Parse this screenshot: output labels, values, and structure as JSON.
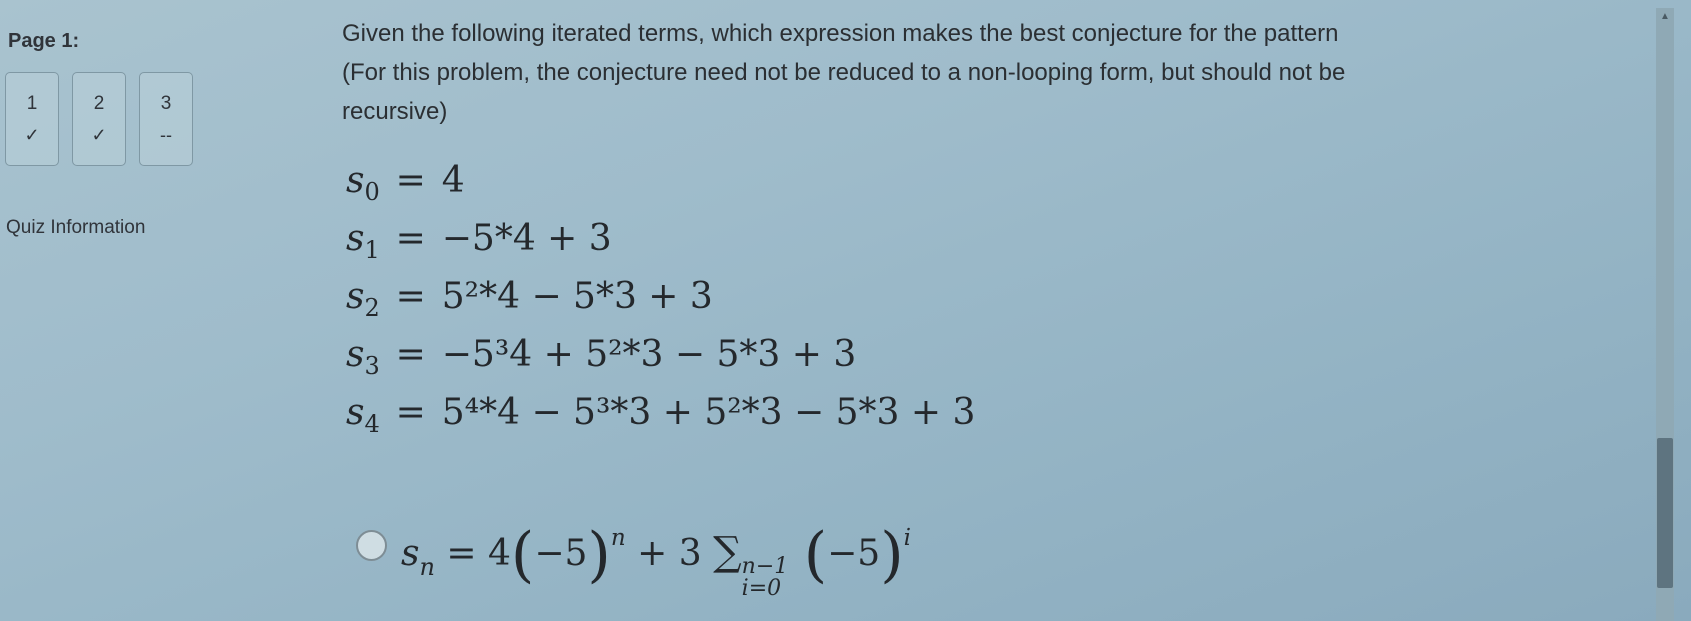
{
  "sidebar": {
    "page_label": "Page 1:",
    "questions": [
      {
        "number": "1",
        "status": "✓",
        "answered": true
      },
      {
        "number": "2",
        "status": "✓",
        "answered": true
      },
      {
        "number": "3",
        "status": "--",
        "answered": false
      }
    ],
    "quiz_info_label": "Quiz Information"
  },
  "question": {
    "prompt": "Given the following iterated terms, which expression makes the best conjecture for the pattern (For this problem, the conjecture need not be reduced to a non-looping form, but should not be recursive)",
    "terms": [
      {
        "var": "s",
        "index": "0",
        "expression": "4"
      },
      {
        "var": "s",
        "index": "1",
        "expression": "−5*4 + 3"
      },
      {
        "var": "s",
        "index": "2",
        "expression": "5²*4 − 5*3 + 3"
      },
      {
        "var": "s",
        "index": "3",
        "expression": "−5³4 + 5²*3 − 5*3 + 3"
      },
      {
        "var": "s",
        "index": "4",
        "expression": "5⁴*4 − 5³*3 + 5²*3 − 5*3 + 3"
      }
    ],
    "option": {
      "lhs_var": "s",
      "lhs_index": "n",
      "coef": "4",
      "base": "−5",
      "exp1": "n",
      "plus": "+ 3",
      "sum_symbol": "∑",
      "sum_upper": "n−1",
      "sum_lower": "i=0",
      "exp2": "i"
    }
  },
  "colors": {
    "background": "#9fbccb",
    "text": "#2b2f33",
    "scrollbar_thumb": "#5e7480"
  }
}
